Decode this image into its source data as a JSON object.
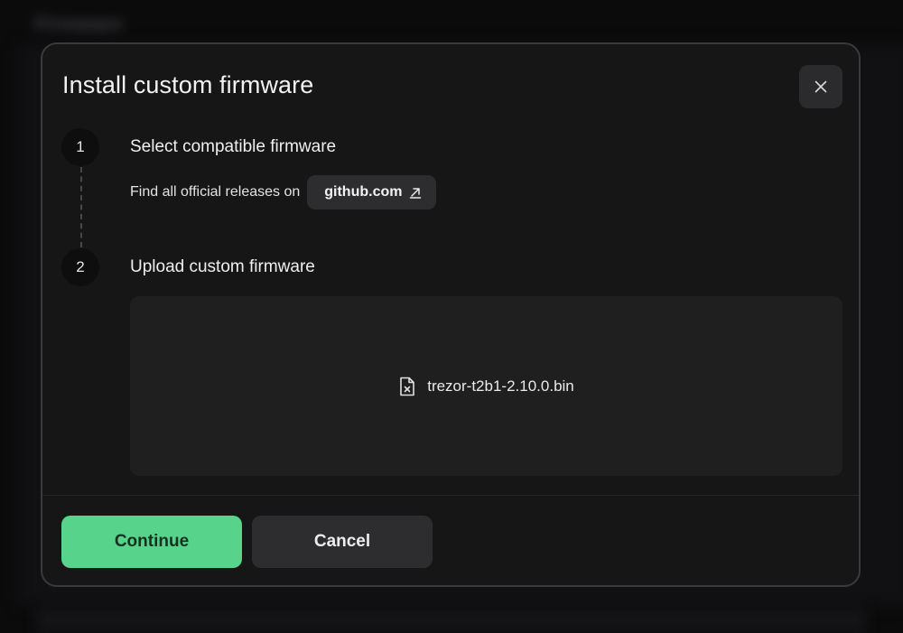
{
  "background": {
    "title": "Firmware"
  },
  "modal": {
    "title": "Install custom firmware",
    "close_icon": "close-icon"
  },
  "steps": [
    {
      "number": "1",
      "title": "Select compatible firmware",
      "description": "Find all official releases on",
      "link_label": "github.com",
      "link_icon": "external-link-icon"
    },
    {
      "number": "2",
      "title": "Upload custom firmware",
      "file_name": "trezor-t2b1-2.10.0.bin",
      "file_icon": "file-icon"
    }
  ],
  "footer": {
    "continue_label": "Continue",
    "cancel_label": "Cancel"
  },
  "colors": {
    "accent": "#58d38c",
    "modal_bg": "#161617",
    "button_secondary": "#2d2d2f"
  }
}
